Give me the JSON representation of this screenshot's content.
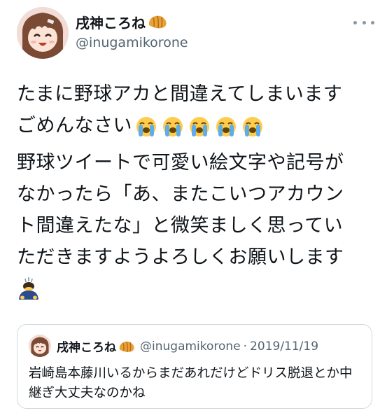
{
  "tweet": {
    "author": {
      "display_name": "戌神ころね",
      "handle": "@inugamikorone",
      "name_emoji": "croissant-icon"
    },
    "body": {
      "para1_line1": "たまに野球アカと間違えてしまいます",
      "para1_line2": "ごめんなさい",
      "para1_emojis": [
        "loudly-crying-face-icon",
        "loudly-crying-face-icon",
        "loudly-crying-face-icon",
        "loudly-crying-face-icon",
        "loudly-crying-face-icon"
      ],
      "para2_line1": "野球ツイートで可愛い絵文字や記号が",
      "para2_line2": "なかったら「あ、またこいつアカウン",
      "para2_line3": "ト間違えたな」と微笑ましく思ってい",
      "para2_line4": "ただきますようよろしくお願いします",
      "para2_emoji": "person-bowing-icon"
    },
    "quoted": {
      "display_name": "戌神ころね",
      "handle": "@inugamikorone",
      "separator": "·",
      "date": "2019/11/19",
      "text": "岩崎島本藤川いるからまだあれだけどドリス脱退とか中継ぎ大丈夫なのかね"
    }
  },
  "colors": {
    "text_primary": "#0f1419",
    "text_secondary": "#536471",
    "border": "#cfd9de"
  }
}
